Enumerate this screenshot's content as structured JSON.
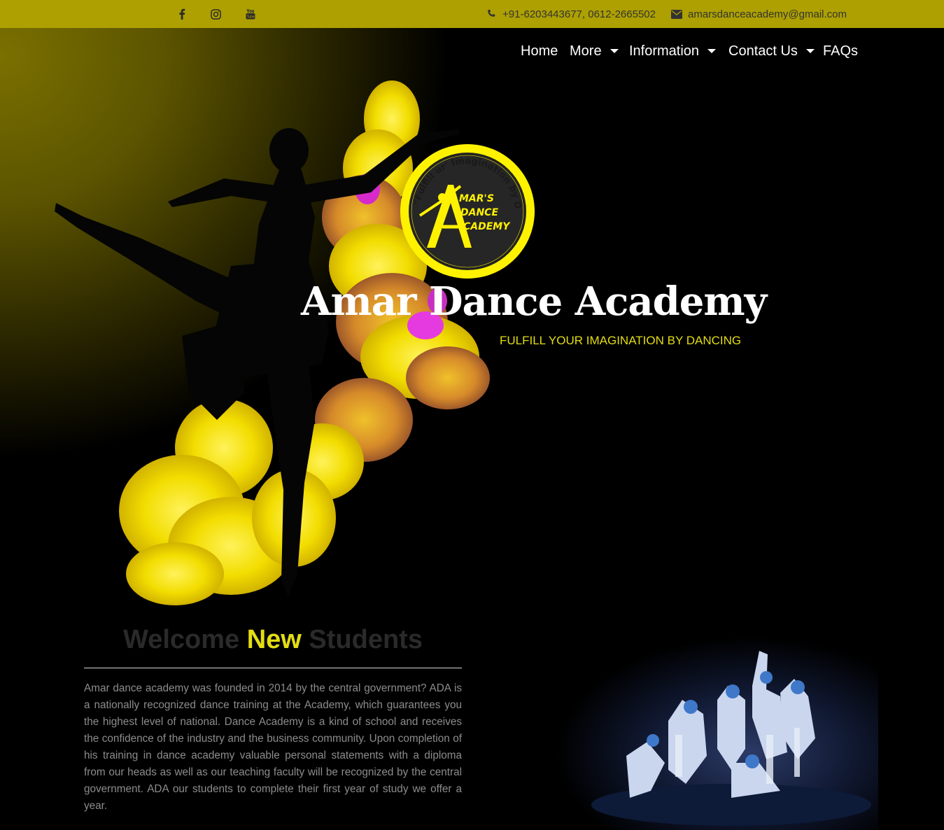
{
  "topbar": {
    "social": [
      {
        "name": "facebook-icon"
      },
      {
        "name": "instagram-icon"
      },
      {
        "name": "youtube-icon"
      }
    ],
    "phone": "+91-6203443677, 0612-2665502",
    "email": "amarsdanceacademy@gmail.com"
  },
  "nav": {
    "items": [
      {
        "label": "Home",
        "dropdown": false
      },
      {
        "label": "More",
        "dropdown": true
      },
      {
        "label": "Information",
        "dropdown": true
      },
      {
        "label": "Contact Us",
        "dropdown": true
      },
      {
        "label": "FAQs",
        "dropdown": false
      }
    ]
  },
  "hero": {
    "title": "Amar Dance Academy",
    "subtitle": "FULFILL YOUR IMAGINATION BY DANCING",
    "logo": {
      "ring_text": "\"Fulfill ur' Imagination by Dancing\"",
      "line1": "MAR'S",
      "line2": "DANCE",
      "line3": "CADEMY"
    }
  },
  "welcome": {
    "title_part1": "Welcome ",
    "title_highlight": "New",
    "title_part2": " Students",
    "body": "Amar dance academy was founded in 2014 by the central government? ADA is a nationally recognized dance training at the Academy, which guarantees you the highest level of national. Dance Academy is a kind of school and receives the confidence of the industry and the business community. Upon completion of his training in dance academy valuable personal statements with a diploma from our heads as well as our teaching faculty will be recognized by the central government. ADA our students to complete their first year of study we offer a year."
  },
  "colors": {
    "topbar": "#ada000",
    "accent_yellow": "#e3dd12",
    "background": "#000000"
  }
}
